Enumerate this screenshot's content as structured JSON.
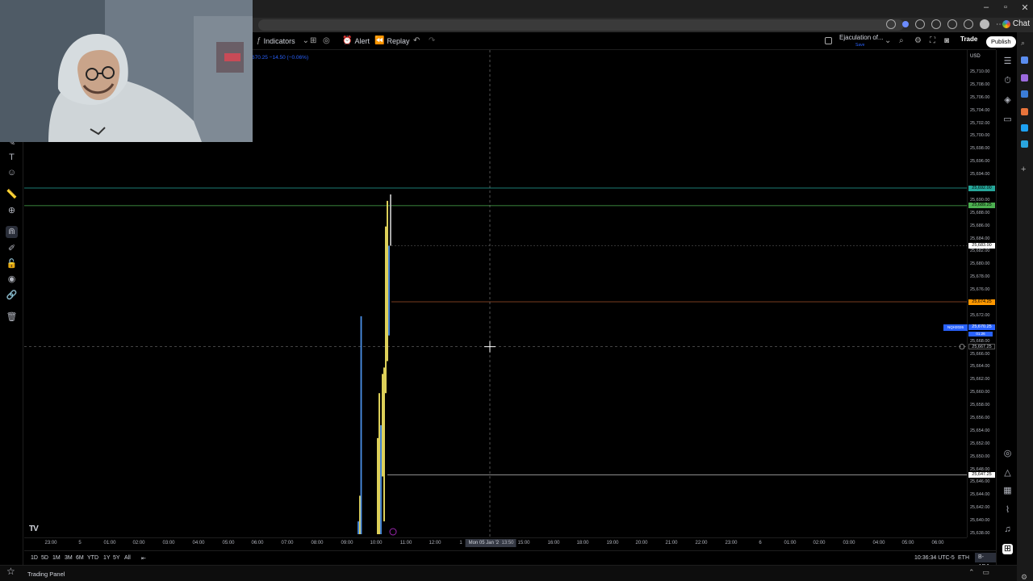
{
  "window": {
    "minimize": "–",
    "maximize": "▫",
    "close": "✕"
  },
  "browser": {
    "chat_label": "Chat"
  },
  "toolbar": {
    "indicators_label": "Indicators",
    "alert_label": "Alert",
    "replay_label": "Replay",
    "layout_name": "Ejaculation of...",
    "layout_status": "Save",
    "trade_label": "Trade",
    "publish_label": "Publish"
  },
  "legend": {
    "text": "670.25 −14.50 (−0.06%)"
  },
  "price_axis": {
    "currency": "USD",
    "ticks": [
      "25,710.00",
      "25,708.00",
      "25,706.00",
      "25,704.00",
      "25,702.00",
      "25,700.00",
      "25,698.00",
      "25,696.00",
      "25,694.00",
      "25,690.00",
      "25,688.00",
      "25,686.00",
      "25,684.00",
      "25,682.00",
      "25,680.00",
      "25,678.00",
      "25,676.00",
      "25,672.00",
      "25,668.00",
      "25,666.00",
      "25,664.00",
      "25,662.00",
      "25,660.00",
      "25,658.00",
      "25,656.00",
      "25,654.00",
      "25,652.00",
      "25,650.00",
      "25,648.00",
      "25,646.00",
      "25,644.00",
      "25,642.00",
      "25,640.00",
      "25,638.00"
    ],
    "tags": [
      {
        "label": "25,692.00",
        "color": "#26a69a"
      },
      {
        "label": "25,689.25",
        "color": "#4caf50"
      },
      {
        "label": "25,683.00",
        "color": "#ffffff"
      },
      {
        "label": "25,674.25",
        "color": "#ff9800"
      },
      {
        "label": "25,670.25",
        "color": "#2962ff"
      },
      {
        "label": "25,667.25",
        "color": "#000000"
      },
      {
        "label": "25,647.25",
        "color": "#ffffff"
      }
    ],
    "symbol_tag": "NQH2026",
    "countdown": "01:26"
  },
  "time_axis": {
    "labels": [
      "23:00",
      "5",
      "01:00",
      "02:00",
      "03:00",
      "04:00",
      "05:00",
      "06:00",
      "07:00",
      "08:00",
      "09:00",
      "10:00",
      "11:00",
      "12:00",
      "1",
      "13:50",
      "15:00",
      "16:00",
      "18:00",
      "19:00",
      "20:00",
      "21:00",
      "22:00",
      "23:00",
      "6",
      "01:00",
      "02:00",
      "03:00",
      "04:00",
      "05:00",
      "06:00"
    ],
    "crosshair": "Mon 05 Jan '26"
  },
  "bottom_bar": {
    "ranges": [
      "1D",
      "5D",
      "1M",
      "3M",
      "6M",
      "YTD",
      "1Y",
      "5Y",
      "All"
    ],
    "clock": "10:36:34 UTC-5",
    "session": "ETH",
    "adjustment": "B-ADJ"
  },
  "panel": {
    "label": "Trading Panel"
  },
  "colors": {
    "background": "#000000",
    "candle_up": "#f5e663",
    "candle_alt": "#4a8fe8",
    "line_teal": "#26a69a",
    "line_orange": "#ff9800",
    "accent": "#2962ff"
  }
}
